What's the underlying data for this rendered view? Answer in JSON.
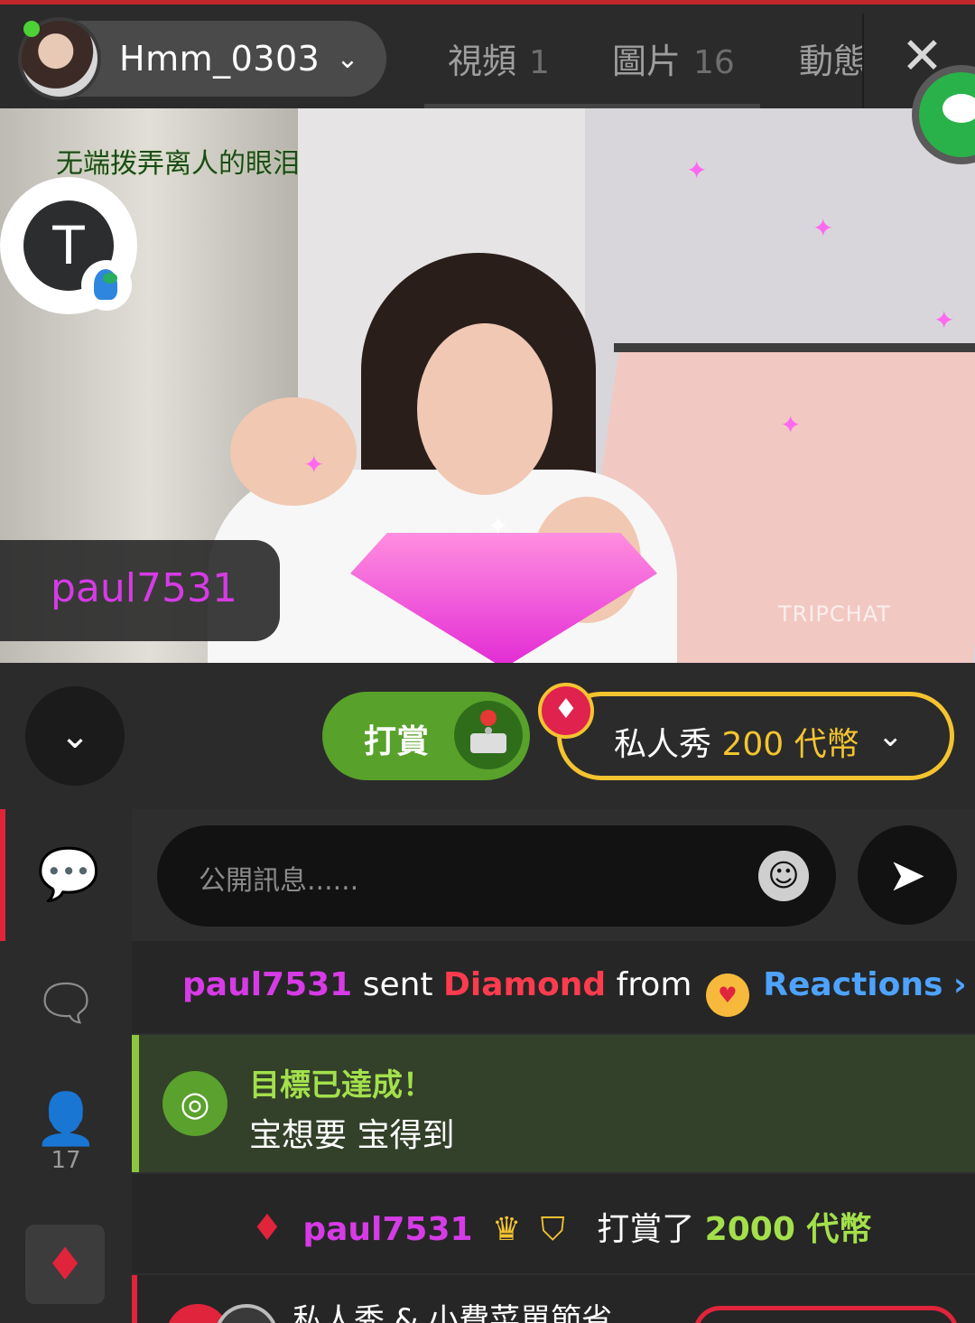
{
  "header": {
    "username": "Hmm_0303",
    "tabs": [
      {
        "label": "視頻",
        "count": "1"
      },
      {
        "label": "圖片",
        "count": "16"
      },
      {
        "label": "動態",
        "count": ""
      }
    ],
    "close_symbol": "✕",
    "chevron_symbol": "⌄"
  },
  "video": {
    "lyric": "无端拨弄离人的眼泪",
    "profile_initial": "T",
    "tipper_overlay_name": "paul7531",
    "watermark": "TRIPCHAT"
  },
  "actions": {
    "tip_label": "打賞",
    "private_prefix": "私人秀",
    "private_price": "200 代幣",
    "badge_symbol": "♦",
    "chevron_symbol": "⌄",
    "collapse_symbol": "⌄"
  },
  "rail": {
    "users_count": "17"
  },
  "chat": {
    "input_placeholder": "公開訊息......",
    "send_symbol": "➤",
    "emoji_symbol": "☺",
    "gift_message": {
      "user": "paul7531",
      "sent_text": "sent",
      "gift": "Diamond",
      "from_text": "from",
      "source": "Reactions",
      "arrow": "›"
    },
    "goal_message": {
      "title": "目標已達成！",
      "description": "宝想要 宝得到"
    },
    "tip_message": {
      "user": "paul7531",
      "action": "打賞了",
      "amount": "2000 代幣"
    },
    "menu_message": {
      "text": "私人秀 & 小費菜單節省"
    }
  },
  "colors": {
    "accent_red": "#e0243c",
    "tip_green": "#58a12b",
    "gold": "#f4c430",
    "username_pink": "#d63be6",
    "reactions_blue": "#4da3ff",
    "goal_green": "#a3e04b"
  },
  "icons": [
    "wechat-icon",
    "chat-bubble-icon",
    "group-chat-icon",
    "user-icon",
    "gift-diamond-icon",
    "emoji-icon",
    "send-icon",
    "target-icon",
    "crown-icon",
    "shield-icon",
    "joystick-icon",
    "parrot-icon"
  ]
}
